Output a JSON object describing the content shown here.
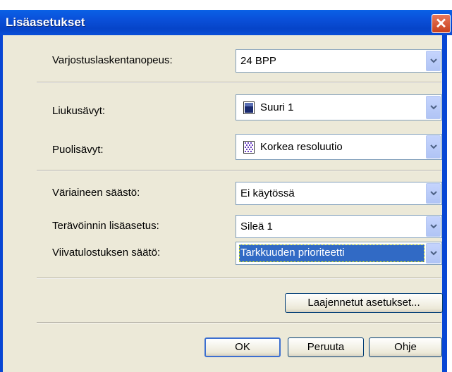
{
  "window": {
    "title": "Lisäasetukset"
  },
  "settings": {
    "shading": {
      "label": "Varjostuslaskentanopeus:",
      "value": "24 BPP"
    },
    "gradients": {
      "label": "Liukusävyt:",
      "value": "Suuri 1"
    },
    "halftones": {
      "label": "Puolisävyt:",
      "value": "Korkea resoluutio"
    },
    "toner_save": {
      "label": "Väriaineen säästö:",
      "value": "Ei käytössä"
    },
    "sharpening": {
      "label": "Terävöinnin lisäasetus:",
      "value": "Sileä 1"
    },
    "line_printing": {
      "label": "Viivatulostuksen säätö:",
      "value": "Tarkkuuden prioriteetti"
    }
  },
  "buttons": {
    "advanced": "Laajennetut asetukset...",
    "ok": "OK",
    "cancel": "Peruuta",
    "help": "Ohje"
  },
  "colors": {
    "title_bar": "#0a4fd8",
    "dialog_bg": "#ece9d8",
    "selection": "#316ac5",
    "close_button": "#d0532f"
  }
}
